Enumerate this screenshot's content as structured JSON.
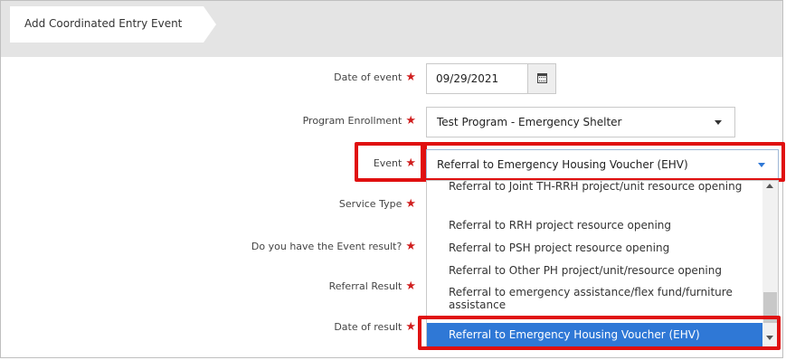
{
  "tab": {
    "label": "Add Coordinated Entry Event"
  },
  "form": {
    "date_of_event": {
      "label": "Date of event",
      "value": "09/29/2021"
    },
    "program_enrollment": {
      "label": "Program Enrollment",
      "value": "Test Program - Emergency Shelter"
    },
    "event": {
      "label": "Event",
      "value": "Referral to Emergency Housing Voucher (EHV)"
    },
    "service_type": {
      "label": "Service Type"
    },
    "event_result": {
      "label": "Do you have the Event result?"
    },
    "referral_result": {
      "label": "Referral Result"
    },
    "date_of_result": {
      "label": "Date of result"
    }
  },
  "required_marker": "★",
  "dropdown": {
    "options": [
      "Referral to Joint TH-RRH project/unit resource opening",
      "Referral to RRH project resource opening",
      "Referral to PSH project resource opening",
      "Referral to Other PH project/unit/resource opening",
      "Referral to emergency assistance/flex fund/furniture assistance",
      "Referral to Emergency Housing Voucher (EHV)"
    ],
    "selected_index": 5
  },
  "icons": {
    "calendar": "calendar-icon",
    "select_caret": "chevron-down-icon"
  },
  "colors": {
    "required_star": "#d01f1f",
    "highlight": "#e01010",
    "selected_option": "#2f78d6"
  }
}
